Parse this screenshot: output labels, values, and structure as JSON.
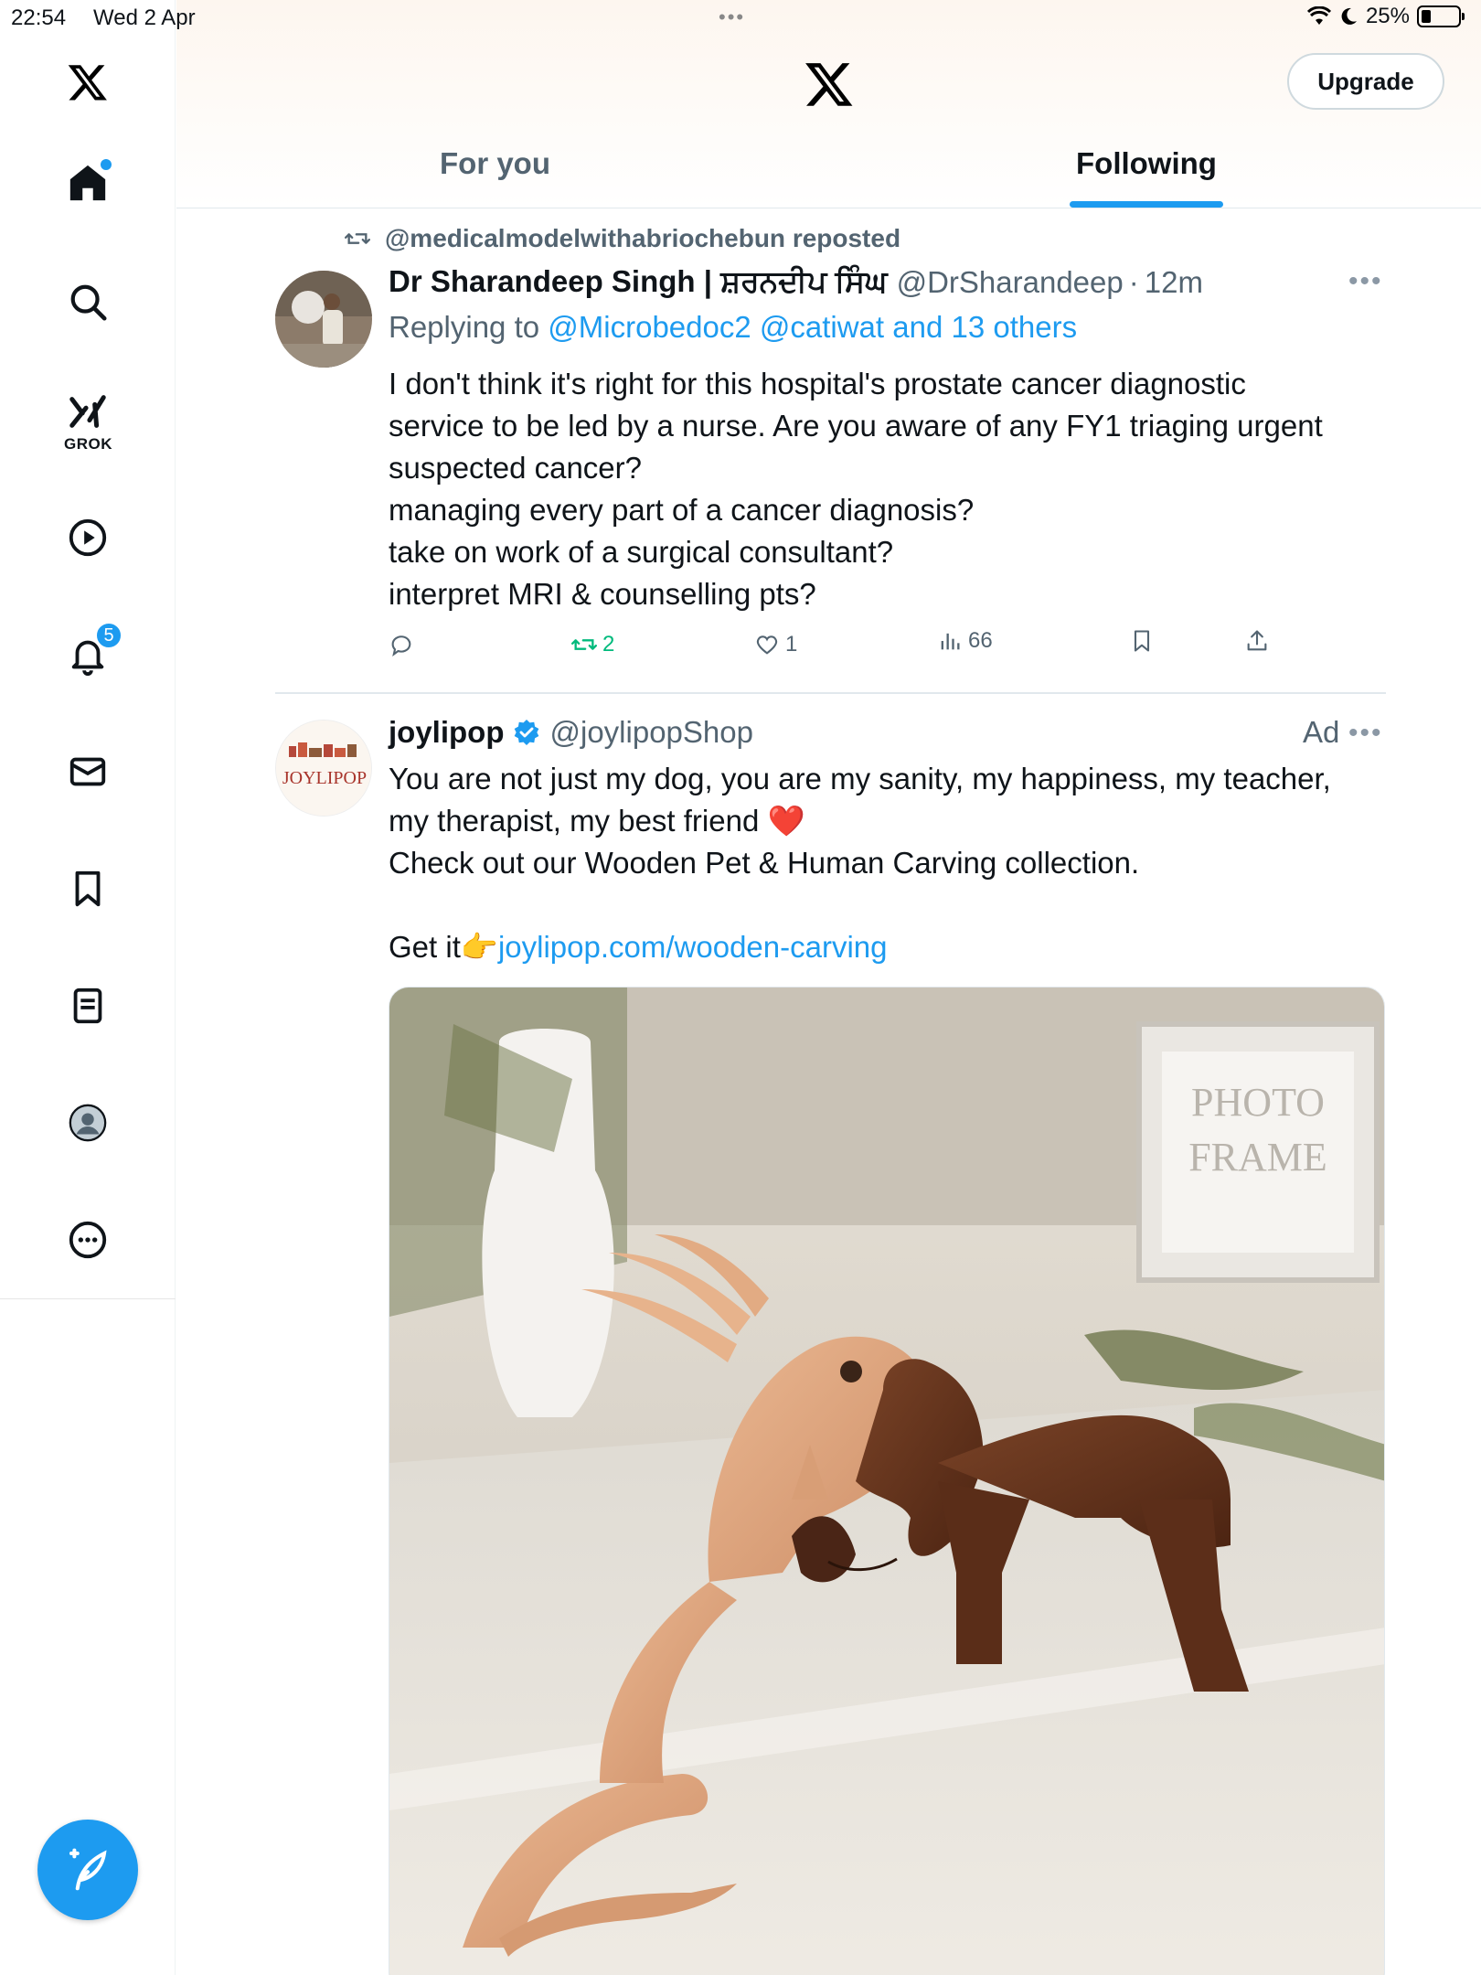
{
  "status_bar": {
    "time": "22:54",
    "date": "Wed 2 Apr",
    "battery": "25%",
    "battery_level": 0.25
  },
  "sidebar": {
    "items": [
      {
        "icon": "home-icon",
        "has_dot": true
      },
      {
        "icon": "search-icon"
      },
      {
        "icon": "grok-icon",
        "label": "GROK"
      },
      {
        "icon": "video-play-icon"
      },
      {
        "icon": "bell-icon",
        "badge": "5"
      },
      {
        "icon": "mail-icon"
      },
      {
        "icon": "bookmark-icon"
      },
      {
        "icon": "lists-icon"
      },
      {
        "icon": "profile-icon"
      },
      {
        "icon": "more-circle-icon"
      }
    ],
    "compose_icon": "compose-icon"
  },
  "header": {
    "upgrade_label": "Upgrade",
    "tabs": [
      {
        "label": "For you",
        "active": false
      },
      {
        "label": "Following",
        "active": true
      }
    ]
  },
  "colors": {
    "accent": "#1d9bf0",
    "text_primary": "#0f1419",
    "text_secondary": "#536471",
    "retweet_green": "#00ba7c"
  },
  "tweets": [
    {
      "repost_by": "@medicalmodelwithabriochebun reposted",
      "author_name": "Dr Sharandeep Singh | ਸ਼ਰਨਦੀਪ ਸਿੰਘ",
      "author_handle": "@DrSharandeep",
      "separator": "·",
      "time": "12m",
      "reply_prefix": "Replying to",
      "reply_targets": "@Microbedoc2 @catiwat and 13 others",
      "body_lines": [
        "I don't think it's right for this hospital's prostate cancer diagnostic",
        "service to be led by a nurse. Are you aware of any FY1 triaging urgent",
        "suspected cancer?",
        "managing every part of a cancer diagnosis?",
        "take on work of a surgical consultant?",
        "interpret MRI & counselling pts?"
      ],
      "stats": {
        "replies": "",
        "reposts": "2",
        "likes": "1",
        "views": "66"
      }
    },
    {
      "author_name": "joylipop",
      "verified": true,
      "author_handle": "@joylipopShop",
      "ad_label": "Ad",
      "avatar_text": "JOYLIPOP",
      "body_lines": [
        "You are not just my dog, you are my sanity, my happiness, my teacher,",
        "my therapist, my best friend ❤️",
        "Check out our Wooden Pet & Human Carving collection."
      ],
      "cta_prefix": "Get it👉",
      "cta_link": "joylipop.com/wooden-carving"
    }
  ]
}
